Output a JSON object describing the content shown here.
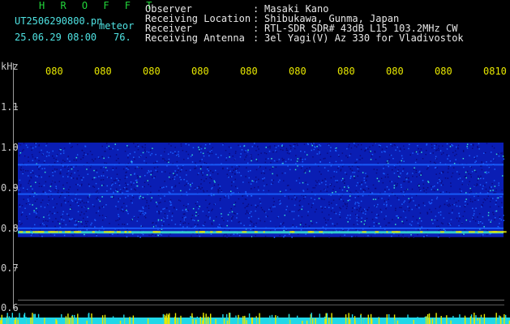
{
  "header": {
    "brand": "H R O F F T",
    "filename": "UT2506290800.pn",
    "tag": "meteor",
    "datetime": "25.06.29 08:00",
    "count": "76."
  },
  "info": [
    {
      "label": "Observer",
      "value": "Masaki Kano"
    },
    {
      "label": "Receiving Location",
      "value": "Shibukawa, Gunma, Japan"
    },
    {
      "label": "Receiver",
      "value": "RTL-SDR SDR# 43dB L15 103.2MHz CW"
    },
    {
      "label": "Receiving Antenna",
      "value": "3el Yagi(V) Az 330 for Vladivostok"
    }
  ],
  "colon": ":",
  "axis": {
    "y_unit": "kHz",
    "y_ticks": [
      "1.1",
      "1.0",
      "0.9",
      "0.8",
      "0.7",
      "0.6"
    ],
    "x_ticks": [
      "080",
      "080",
      "080",
      "080",
      "080",
      "080",
      "080",
      "080",
      "080",
      "0810"
    ]
  },
  "colors": {
    "background": "#000000",
    "noise_low": "#0a1eb4",
    "noise_high": "#1a60ff",
    "signal": "#38e0d0",
    "strong": "#e8e800",
    "brand": "#22d63a",
    "info": "#4fe3e3"
  },
  "spectrogram": {
    "band_top_khz": 1.01,
    "band_bottom_khz": 0.775,
    "lines_khz": [
      0.955,
      0.882,
      0.797,
      0.788
    ],
    "strong_line_khz": 0.788
  }
}
